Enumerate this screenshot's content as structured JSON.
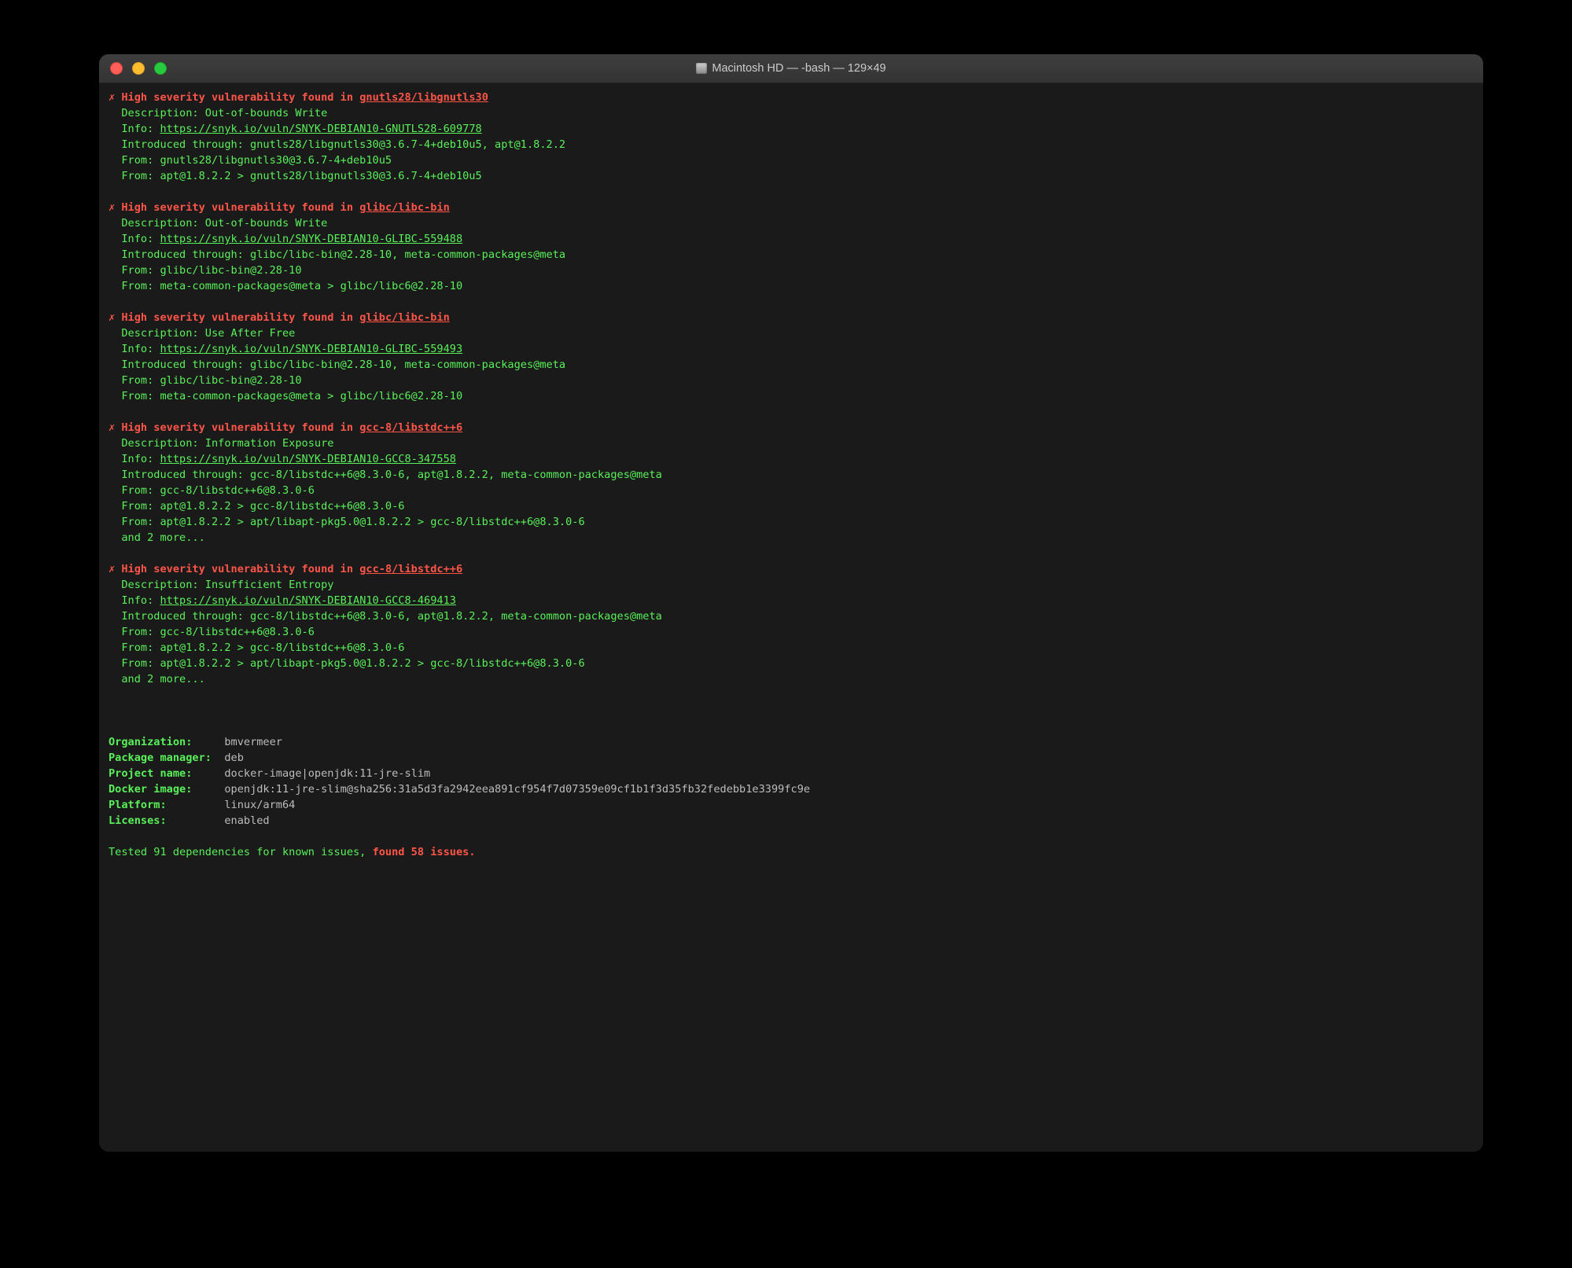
{
  "window": {
    "title": "Macintosh HD — -bash — 129×49"
  },
  "vulns": [
    {
      "header_prefix": "High severity vulnerability found in ",
      "pkg": "gnutls28/libgnutls30",
      "description": "Out-of-bounds Write",
      "info_url": "https://snyk.io/vuln/SNYK-DEBIAN10-GNUTLS28-609778",
      "introduced": "gnutls28/libgnutls30@3.6.7-4+deb10u5, apt@1.8.2.2",
      "froms": [
        "gnutls28/libgnutls30@3.6.7-4+deb10u5",
        "apt@1.8.2.2 > gnutls28/libgnutls30@3.6.7-4+deb10u5"
      ],
      "more": ""
    },
    {
      "header_prefix": "High severity vulnerability found in ",
      "pkg": "glibc/libc-bin",
      "description": "Out-of-bounds Write",
      "info_url": "https://snyk.io/vuln/SNYK-DEBIAN10-GLIBC-559488",
      "introduced": "glibc/libc-bin@2.28-10, meta-common-packages@meta",
      "froms": [
        "glibc/libc-bin@2.28-10",
        "meta-common-packages@meta > glibc/libc6@2.28-10"
      ],
      "more": ""
    },
    {
      "header_prefix": "High severity vulnerability found in ",
      "pkg": "glibc/libc-bin",
      "description": "Use After Free",
      "info_url": "https://snyk.io/vuln/SNYK-DEBIAN10-GLIBC-559493",
      "introduced": "glibc/libc-bin@2.28-10, meta-common-packages@meta",
      "froms": [
        "glibc/libc-bin@2.28-10",
        "meta-common-packages@meta > glibc/libc6@2.28-10"
      ],
      "more": ""
    },
    {
      "header_prefix": "High severity vulnerability found in ",
      "pkg": "gcc-8/libstdc++6",
      "description": "Information Exposure",
      "info_url": "https://snyk.io/vuln/SNYK-DEBIAN10-GCC8-347558",
      "introduced": "gcc-8/libstdc++6@8.3.0-6, apt@1.8.2.2, meta-common-packages@meta",
      "froms": [
        "gcc-8/libstdc++6@8.3.0-6",
        "apt@1.8.2.2 > gcc-8/libstdc++6@8.3.0-6",
        "apt@1.8.2.2 > apt/libapt-pkg5.0@1.8.2.2 > gcc-8/libstdc++6@8.3.0-6"
      ],
      "more": "and 2 more..."
    },
    {
      "header_prefix": "High severity vulnerability found in ",
      "pkg": "gcc-8/libstdc++6",
      "description": "Insufficient Entropy",
      "info_url": "https://snyk.io/vuln/SNYK-DEBIAN10-GCC8-469413",
      "introduced": "gcc-8/libstdc++6@8.3.0-6, apt@1.8.2.2, meta-common-packages@meta",
      "froms": [
        "gcc-8/libstdc++6@8.3.0-6",
        "apt@1.8.2.2 > gcc-8/libstdc++6@8.3.0-6",
        "apt@1.8.2.2 > apt/libapt-pkg5.0@1.8.2.2 > gcc-8/libstdc++6@8.3.0-6"
      ],
      "more": "and 2 more..."
    }
  ],
  "labels": {
    "description": "Description: ",
    "info": "Info: ",
    "introduced": "Introduced through: ",
    "from": "From: "
  },
  "summary": {
    "rows": [
      {
        "label": "Organization:",
        "value": "bmvermeer"
      },
      {
        "label": "Package manager:",
        "value": "deb"
      },
      {
        "label": "Project name:",
        "value": "docker-image|openjdk:11-jre-slim"
      },
      {
        "label": "Docker image:",
        "value": "openjdk:11-jre-slim@sha256:31a5d3fa2942eea891cf954f7d07359e09cf1b1f3d35fb32fedebb1e3399fc9e"
      },
      {
        "label": "Platform:",
        "value": "linux/arm64"
      },
      {
        "label": "Licenses:",
        "value": "enabled"
      }
    ]
  },
  "footer": {
    "prefix": "Tested 91 dependencies for known issues, ",
    "highlight": "found 58 issues."
  },
  "marker": "✗"
}
